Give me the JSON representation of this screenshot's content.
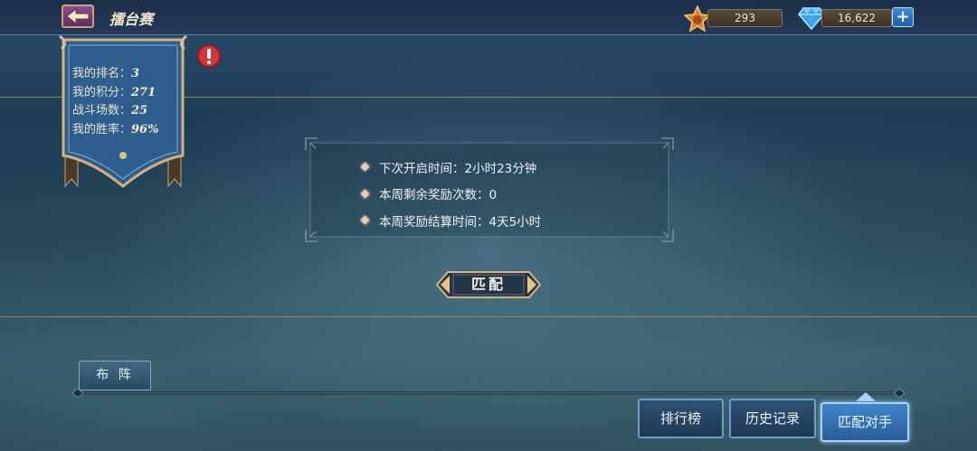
{
  "header": {
    "title": "擂台赛",
    "currency_medal": "293",
    "currency_gem": "16,622"
  },
  "player_stats": {
    "rank_label": "我的排名：",
    "rank_value": "3",
    "points_label": "我的积分：",
    "points_value": "271",
    "battles_label": "战斗场数：",
    "battles_value": "25",
    "winrate_label": "我的胜率：",
    "winrate_value": "96%"
  },
  "info": {
    "items": [
      "下次开启时间：2小时23分钟",
      "本周剩余奖励次数：0",
      "本周奖励结算时间：4天5小时"
    ]
  },
  "actions": {
    "match_label": "匹配",
    "lineup_label": "布 阵"
  },
  "tabs": [
    {
      "label": "排行榜",
      "active": false
    },
    {
      "label": "历史记录",
      "active": false
    },
    {
      "label": "匹配对手",
      "active": true
    }
  ],
  "colors": {
    "gold_trim": "#c9a36a",
    "tab_active": "#3f85c9",
    "alert": "#d9343a"
  }
}
